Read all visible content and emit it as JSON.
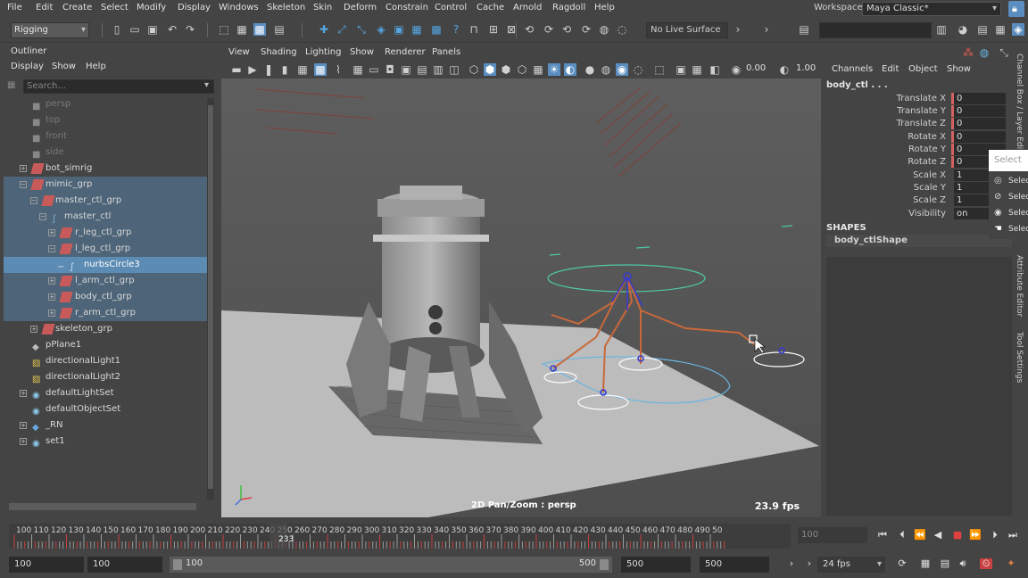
{
  "menubar": {
    "items": [
      "File",
      "Edit",
      "Create",
      "Select",
      "Modify",
      "Display",
      "Windows",
      "Skeleton",
      "Skin",
      "Deform",
      "Constrain",
      "Control",
      "Cache",
      "Arnold",
      "Ragdoll",
      "Help"
    ],
    "workspace_label": "Workspace :",
    "workspace_value": "Maya Classic*"
  },
  "shelf": {
    "mode": "Rigging",
    "live_surface": "No Live Surface"
  },
  "outliner": {
    "title": "Outliner",
    "menu": [
      "Display",
      "Show",
      "Help"
    ],
    "search_placeholder": "Search...",
    "items": [
      {
        "label": "persp",
        "dim": true
      },
      {
        "label": "top",
        "dim": true
      },
      {
        "label": "front",
        "dim": true
      },
      {
        "label": "side",
        "dim": true
      },
      {
        "label": "bot_simrig"
      },
      {
        "label": "mimic_grp"
      },
      {
        "label": "master_ctl_grp"
      },
      {
        "label": "master_ctl"
      },
      {
        "label": "r_leg_ctl_grp"
      },
      {
        "label": "l_leg_ctl_grp"
      },
      {
        "label": "nurbsCircle3"
      },
      {
        "label": "l_arm_ctl_grp"
      },
      {
        "label": "body_ctl_grp"
      },
      {
        "label": "r_arm_ctl_grp"
      },
      {
        "label": "skeleton_grp"
      },
      {
        "label": "pPlane1"
      },
      {
        "label": "directionalLight1"
      },
      {
        "label": "directionalLight2"
      },
      {
        "label": "defaultLightSet"
      },
      {
        "label": "defaultObjectSet"
      },
      {
        "label": "_RN"
      },
      {
        "label": "set1"
      }
    ]
  },
  "viewport": {
    "menu": [
      "View",
      "Shading",
      "Lighting",
      "Show",
      "Renderer",
      "Panels"
    ],
    "exposure": "0.00",
    "gamma": "1.00",
    "camera_label": "2D Pan/Zoom : persp",
    "fps": "23.9 fps"
  },
  "channel_box": {
    "menu": [
      "Channels",
      "Edit",
      "Object",
      "Show"
    ],
    "object": "body_ctl . . .",
    "attributes": [
      {
        "name": "Translate X",
        "value": "0"
      },
      {
        "name": "Translate Y",
        "value": "0"
      },
      {
        "name": "Translate Z",
        "value": "0"
      },
      {
        "name": "Rotate X",
        "value": "0"
      },
      {
        "name": "Rotate Y",
        "value": "0"
      },
      {
        "name": "Rotate Z",
        "value": "0"
      },
      {
        "name": "Scale X",
        "value": "1"
      },
      {
        "name": "Scale Y",
        "value": "1"
      },
      {
        "name": "Scale Z",
        "value": "1"
      },
      {
        "name": "Visibility",
        "value": "on"
      }
    ],
    "shapes_header": "SHAPES",
    "shape_name": "body_ctlShape"
  },
  "side_tabs": [
    "Channel Box / Layer Editor",
    "Attribute Editor",
    "Tool Settings"
  ],
  "popup": {
    "search_placeholder": "Select",
    "items": [
      "Selec",
      "Selec",
      "Selec",
      "Selec"
    ]
  },
  "timeline": {
    "ticks": [
      "100",
      "110",
      "120",
      "130",
      "140",
      "150",
      "160",
      "170",
      "180",
      "190",
      "200",
      "210",
      "220",
      "230",
      "240",
      "250",
      "260",
      "270",
      "280",
      "290",
      "300",
      "310",
      "320",
      "330",
      "340",
      "350",
      "360",
      "370",
      "380",
      "390",
      "400",
      "410",
      "420",
      "430",
      "440",
      "450",
      "460",
      "470",
      "480",
      "490",
      "50"
    ],
    "current_frame": "233",
    "playback_field": "100"
  },
  "range": {
    "start": "100",
    "anim_start": "100",
    "slider_start": "100",
    "slider_end": "500",
    "anim_end": "500",
    "end": "500",
    "fps": "24 fps"
  }
}
